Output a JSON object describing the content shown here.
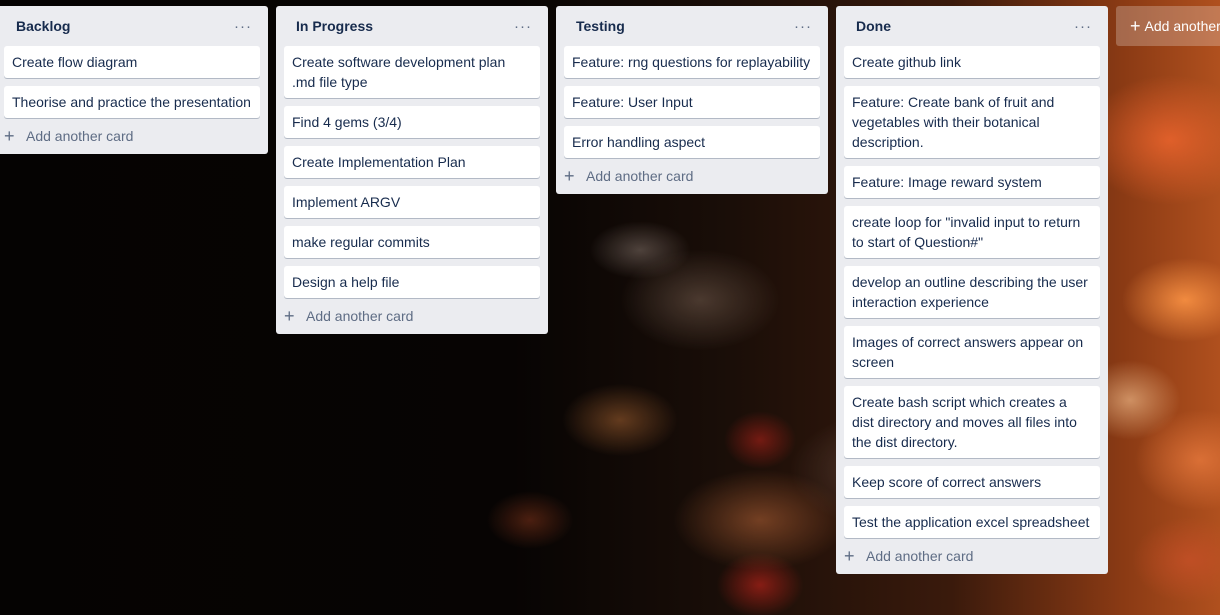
{
  "lists": [
    {
      "title": "Backlog",
      "menu_icon": "ellipsis-icon",
      "cards": [
        "Create flow diagram",
        "Theorise and practice the presentation"
      ],
      "add_label": "Add another card"
    },
    {
      "title": "In Progress",
      "menu_icon": "ellipsis-icon",
      "cards": [
        "Create software development plan .md file type",
        "Find 4 gems (3/4)",
        "Create Implementation Plan",
        "Implement ARGV",
        "make regular commits",
        "Design a help file"
      ],
      "add_label": "Add another card"
    },
    {
      "title": "Testing",
      "menu_icon": "ellipsis-icon",
      "cards": [
        "Feature: rng questions for replayability",
        "Feature: User Input",
        "Error handling aspect"
      ],
      "add_label": "Add another card"
    },
    {
      "title": "Done",
      "menu_icon": "ellipsis-icon",
      "cards": [
        "Create github link",
        "Feature: Create bank of fruit and vegetables with their botanical description.",
        "Feature: Image reward system",
        "create loop for \"invalid input to return to start of Question#\"",
        "develop an outline describing the user interaction experience",
        "Images of correct answers appear on screen",
        "Create bash script which creates a dist directory and moves all files into the dist directory.",
        "Keep score of correct answers",
        "Test the application excel spreadsheet"
      ],
      "add_label": "Add another card"
    }
  ],
  "add_list_label": "Add another list",
  "colors": {
    "list_bg": "#ebecf0",
    "card_bg": "#ffffff",
    "text": "#172b4d",
    "muted": "#5e6c84"
  }
}
